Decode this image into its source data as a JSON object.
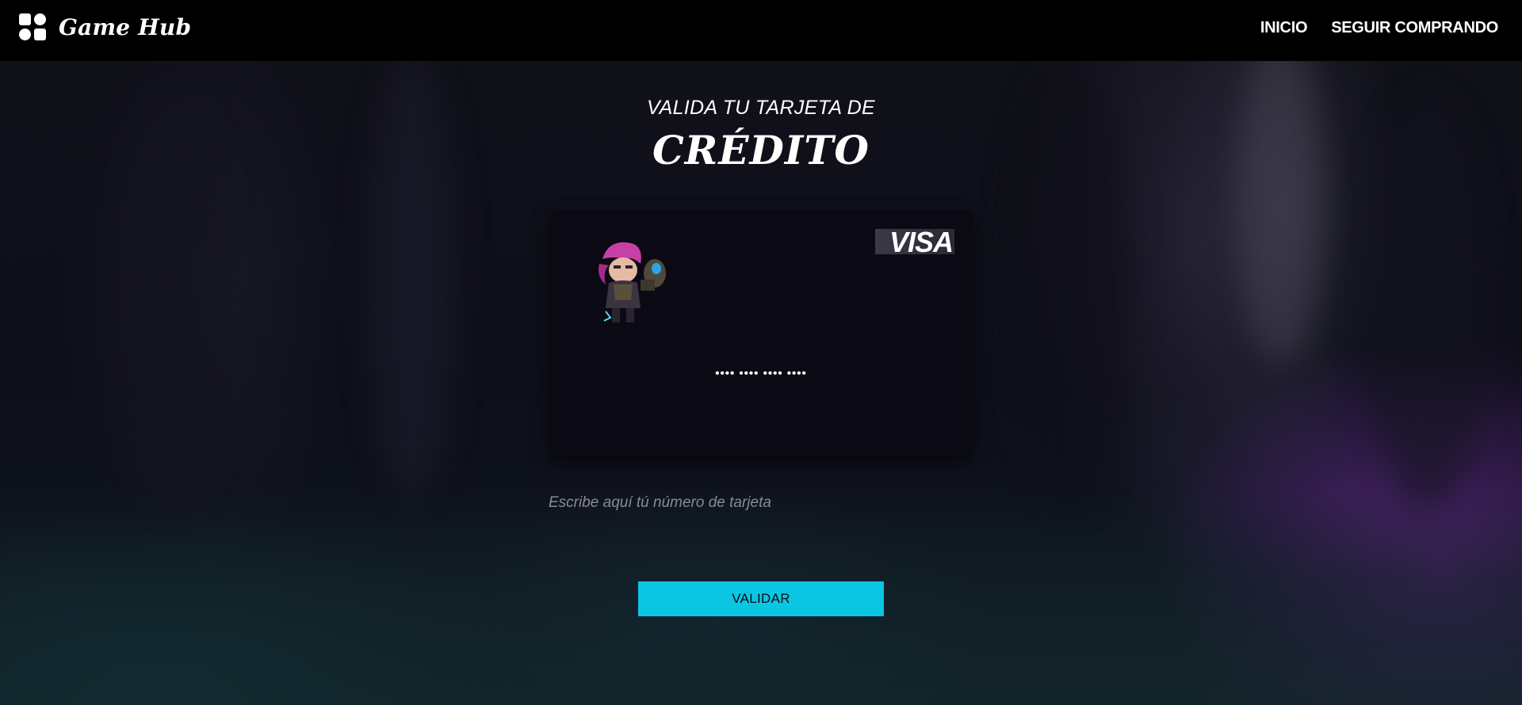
{
  "header": {
    "brand_name": "Game Hub",
    "brand_icon": "apps-grid-icon",
    "nav": [
      {
        "label": "INICIO"
      },
      {
        "label": "SEGUIR COMPRANDO"
      }
    ]
  },
  "main": {
    "heading_top": "VALIDA TU TARJETA DE",
    "heading_main": "CRÉDITO",
    "card": {
      "brand_logo": "VISA",
      "avatar_icon": "champion-avatar-icon",
      "masked_number": "•••• •••• •••• ••••"
    },
    "input": {
      "value": "",
      "placeholder": "Escribe aquí tú número de tarjeta"
    },
    "button_label": "VALIDAR"
  },
  "colors": {
    "header_bg": "#000000",
    "card_bg": "#0b0a14",
    "button_accent": "#0bc6e3"
  }
}
